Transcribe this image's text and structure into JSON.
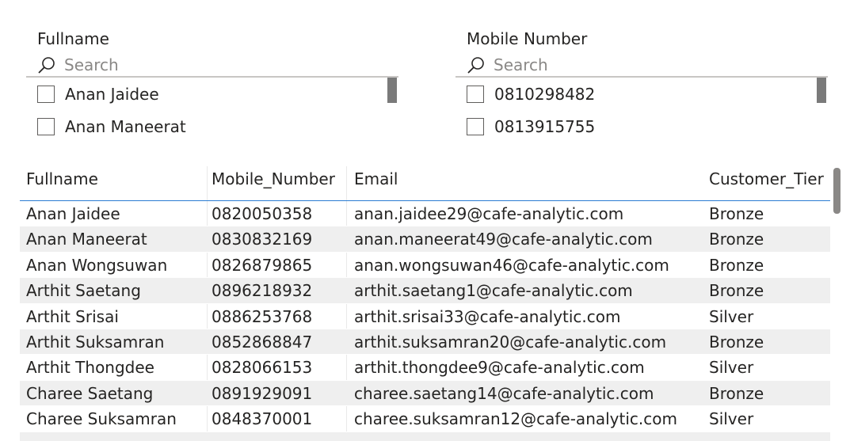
{
  "slicers": [
    {
      "title": "Fullname",
      "search_placeholder": "Search",
      "items": [
        "Anan Jaidee",
        "Anan Maneerat"
      ]
    },
    {
      "title": "Mobile Number",
      "search_placeholder": "Search",
      "items": [
        "0810298482",
        "0813915755"
      ]
    }
  ],
  "table": {
    "columns": [
      "Fullname",
      "Mobile_Number",
      "Email",
      "Customer_Tier"
    ],
    "rows": [
      [
        "Anan Jaidee",
        "0820050358",
        "anan.jaidee29@cafe-analytic.com",
        "Bronze"
      ],
      [
        "Anan Maneerat",
        "0830832169",
        "anan.maneerat49@cafe-analytic.com",
        "Bronze"
      ],
      [
        "Anan Wongsuwan",
        "0826879865",
        "anan.wongsuwan46@cafe-analytic.com",
        "Bronze"
      ],
      [
        "Arthit Saetang",
        "0896218932",
        "arthit.saetang1@cafe-analytic.com",
        "Bronze"
      ],
      [
        "Arthit Srisai",
        "0886253768",
        "arthit.srisai33@cafe-analytic.com",
        "Silver"
      ],
      [
        "Arthit Suksamran",
        "0852868847",
        "arthit.suksamran20@cafe-analytic.com",
        "Bronze"
      ],
      [
        "Arthit Thongdee",
        "0828066153",
        "arthit.thongdee9@cafe-analytic.com",
        "Silver"
      ],
      [
        "Charee Saetang",
        "0891929091",
        "charee.saetang14@cafe-analytic.com",
        "Bronze"
      ],
      [
        "Charee Suksamran",
        "0848370001",
        "charee.suksamran12@cafe-analytic.com",
        "Silver"
      ]
    ]
  },
  "colors": {
    "header_underline": "#2b7cd3",
    "row_alt": "#efefef",
    "text": "#252423"
  }
}
